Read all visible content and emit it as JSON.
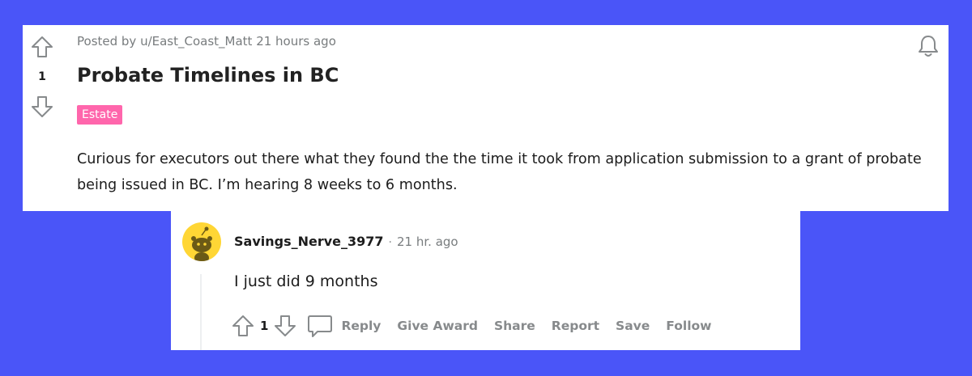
{
  "post": {
    "vote_count": "1",
    "meta": "Posted by u/East_Coast_Matt 21 hours ago",
    "title": "Probate Timelines in BC",
    "flair": "Estate",
    "body": "Curious for executors out there what they found the the time it took from application submission to a grant of probate being issued in BC. I’m hearing 8 weeks to 6 months."
  },
  "comment": {
    "author": "Savings_Nerve_3977",
    "separator": "·",
    "time": "21 hr. ago",
    "text": "I just did 9 months",
    "vote_count": "1",
    "actions": {
      "reply": "Reply",
      "give_award": "Give Award",
      "share": "Share",
      "report": "Report",
      "save": "Save",
      "follow": "Follow"
    }
  },
  "colors": {
    "background": "#4a55f8",
    "card": "#ffffff",
    "flair": "#ff66ac",
    "avatar": "#ffd635",
    "muted_text": "#787c7e",
    "action_text": "#878a8c"
  },
  "icons": {
    "upvote": "arrow-up-outline-icon",
    "downvote": "arrow-down-outline-icon",
    "notification": "bell-icon",
    "reply": "speech-bubble-icon",
    "avatar": "snoo-avatar-icon"
  }
}
